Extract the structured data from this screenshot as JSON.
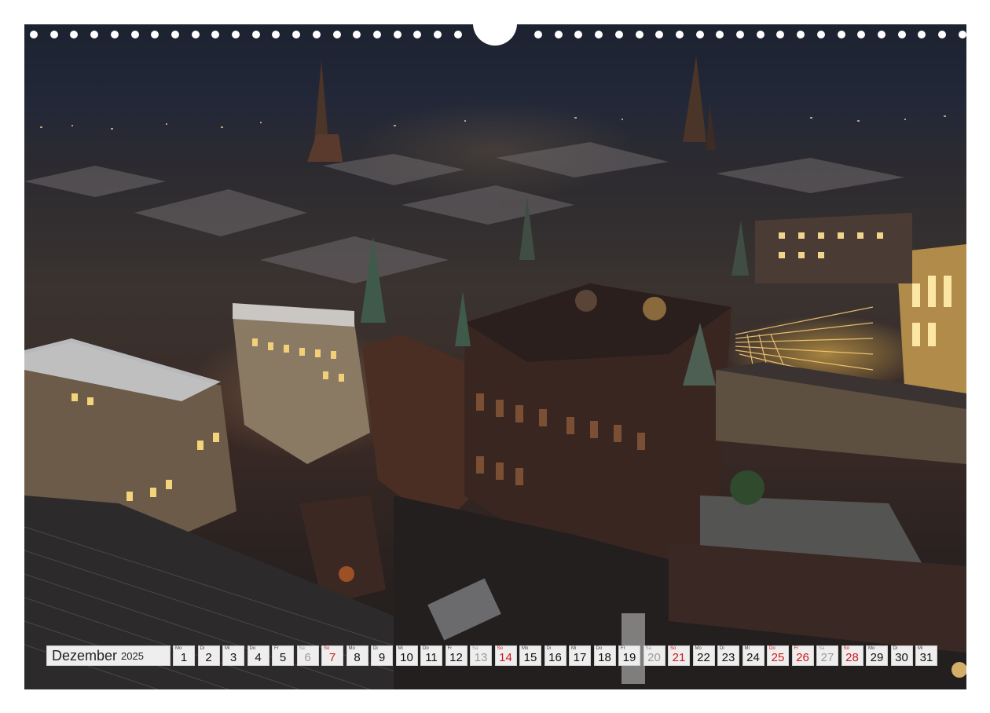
{
  "calendar": {
    "month": "Dezember",
    "year": "2025",
    "days": [
      {
        "wd": "Mo",
        "num": "1",
        "type": "normal"
      },
      {
        "wd": "Di",
        "num": "2",
        "type": "normal"
      },
      {
        "wd": "Mi",
        "num": "3",
        "type": "normal"
      },
      {
        "wd": "Do",
        "num": "4",
        "type": "normal"
      },
      {
        "wd": "Fr",
        "num": "5",
        "type": "normal"
      },
      {
        "wd": "Sa",
        "num": "6",
        "type": "sat"
      },
      {
        "wd": "So",
        "num": "7",
        "type": "sun"
      },
      {
        "wd": "Mo",
        "num": "8",
        "type": "normal"
      },
      {
        "wd": "Di",
        "num": "9",
        "type": "normal"
      },
      {
        "wd": "Mi",
        "num": "10",
        "type": "normal"
      },
      {
        "wd": "Do",
        "num": "11",
        "type": "normal"
      },
      {
        "wd": "Fr",
        "num": "12",
        "type": "normal"
      },
      {
        "wd": "Sa",
        "num": "13",
        "type": "sat"
      },
      {
        "wd": "So",
        "num": "14",
        "type": "sun"
      },
      {
        "wd": "Mo",
        "num": "15",
        "type": "normal"
      },
      {
        "wd": "Di",
        "num": "16",
        "type": "normal"
      },
      {
        "wd": "Mi",
        "num": "17",
        "type": "normal"
      },
      {
        "wd": "Do",
        "num": "18",
        "type": "normal"
      },
      {
        "wd": "Fr",
        "num": "19",
        "type": "normal"
      },
      {
        "wd": "Sa",
        "num": "20",
        "type": "sat"
      },
      {
        "wd": "So",
        "num": "21",
        "type": "sun"
      },
      {
        "wd": "Mo",
        "num": "22",
        "type": "normal"
      },
      {
        "wd": "Di",
        "num": "23",
        "type": "normal"
      },
      {
        "wd": "Mi",
        "num": "24",
        "type": "normal"
      },
      {
        "wd": "Do",
        "num": "25",
        "type": "hol"
      },
      {
        "wd": "Fr",
        "num": "26",
        "type": "hol"
      },
      {
        "wd": "Sa",
        "num": "27",
        "type": "sat"
      },
      {
        "wd": "So",
        "num": "28",
        "type": "sun"
      },
      {
        "wd": "Mo",
        "num": "29",
        "type": "normal"
      },
      {
        "wd": "Di",
        "num": "30",
        "type": "normal"
      },
      {
        "wd": "Mi",
        "num": "31",
        "type": "normal"
      }
    ]
  },
  "colors": {
    "holiday": "#d01818",
    "saturday": "#9a9a9a",
    "cell": "#eeeeee"
  },
  "photo": {
    "icon": "night-cityscape-photo"
  }
}
